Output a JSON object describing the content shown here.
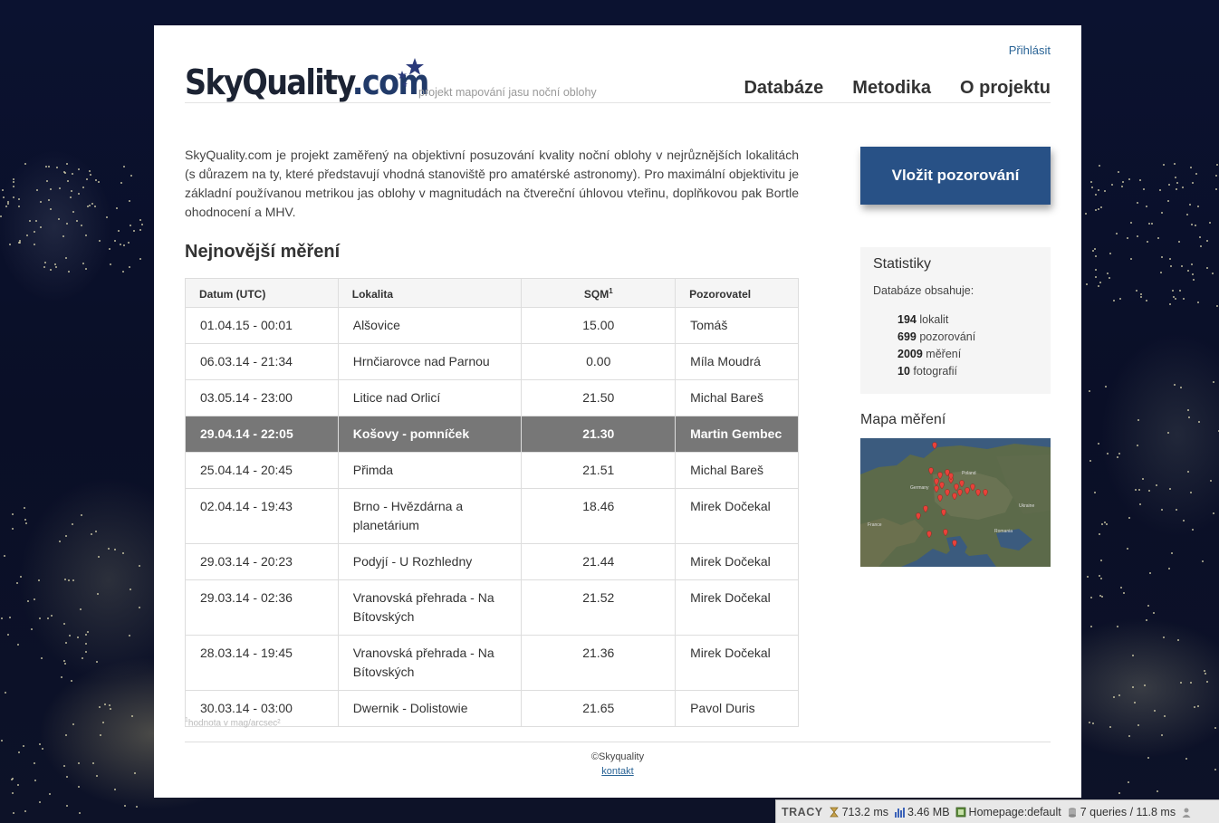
{
  "header": {
    "login": "Přihlásit",
    "logo_main": "SkyQuality",
    "logo_suffix": ".com",
    "tagline": "projekt mapování jasu noční oblohy",
    "nav": [
      "Databáze",
      "Metodika",
      "O projektu"
    ]
  },
  "intro": "SkyQuality.com je projekt zaměřený na objektivní posuzování kvality noční oblohy v nejrůznějších lokalitách (s důrazem na ty, které představují vhodná stanoviště pro amatérské astronomy). Pro maximální objektivitu je základní používanou metrikou jas oblohy v magnitudách na čtvereční úhlovou vteřinu, doplňkovou pak Bortle ohodnocení a MHV.",
  "latest": {
    "title": "Nejnovější měření",
    "columns": {
      "date": "Datum (UTC)",
      "location": "Lokalita",
      "sqm": "SQM",
      "sqm_sup": "1",
      "observer": "Pozorovatel"
    },
    "rows": [
      {
        "date": "01.04.15 - 00:01",
        "location": "Alšovice",
        "sqm": "15.00",
        "observer": "Tomáš"
      },
      {
        "date": "06.03.14 - 21:34",
        "location": "Hrnčiarovce nad Parnou",
        "sqm": "0.00",
        "observer": "Míla Moudrá"
      },
      {
        "date": "03.05.14 - 23:00",
        "location": "Litice nad Orlicí",
        "sqm": "21.50",
        "observer": "Michal Bareš"
      },
      {
        "date": "29.04.14 - 22:05",
        "location": "Košovy - pomníček",
        "sqm": "21.30",
        "observer": "Martin Gembec"
      },
      {
        "date": "25.04.14 - 20:45",
        "location": "Přimda",
        "sqm": "21.51",
        "observer": "Michal Bareš"
      },
      {
        "date": "02.04.14 - 19:43",
        "location": "Brno - Hvězdárna a planetárium",
        "sqm": "18.46",
        "observer": "Mirek Dočekal"
      },
      {
        "date": "29.03.14 - 20:23",
        "location": "Podyjí - U Rozhledny",
        "sqm": "21.44",
        "observer": "Mirek Dočekal"
      },
      {
        "date": "29.03.14 - 02:36",
        "location": "Vranovská přehrada - Na Bítovských",
        "sqm": "21.52",
        "observer": "Mirek Dočekal"
      },
      {
        "date": "28.03.14 - 19:45",
        "location": "Vranovská přehrada - Na Bítovských",
        "sqm": "21.36",
        "observer": "Mirek Dočekal"
      },
      {
        "date": "30.03.14 - 03:00",
        "location": "Dwernik - Dolistowie",
        "sqm": "21.65",
        "observer": "Pavol Duris"
      }
    ],
    "highlighted_row": 3,
    "footnote_sup": "1",
    "footnote": "hodnota v mag/arcsec²"
  },
  "sidebar": {
    "cta": "Vložit pozorování",
    "stats_title": "Statistiky",
    "stats_sub": "Databáze obsahuje:",
    "stats": [
      {
        "count": "194",
        "label": "lokalit"
      },
      {
        "count": "699",
        "label": "pozorování"
      },
      {
        "count": "2009",
        "label": "měření"
      },
      {
        "count": "10",
        "label": "fotografií"
      }
    ],
    "map_title": "Mapa měření",
    "map_labels": [
      "Germany",
      "Poland",
      "France",
      "Ukraine",
      "Romania"
    ]
  },
  "footer": {
    "copyright": "©Skyquality",
    "contact": "kontakt"
  },
  "tracy": {
    "logo": "TRACY",
    "time": "713.2 ms",
    "memory": "3.46 MB",
    "route": "Homepage:default",
    "queries": "7 queries / 11.8 ms"
  },
  "colors": {
    "accent": "#285186",
    "link": "#2a6496",
    "highlight_row": "#777777"
  }
}
